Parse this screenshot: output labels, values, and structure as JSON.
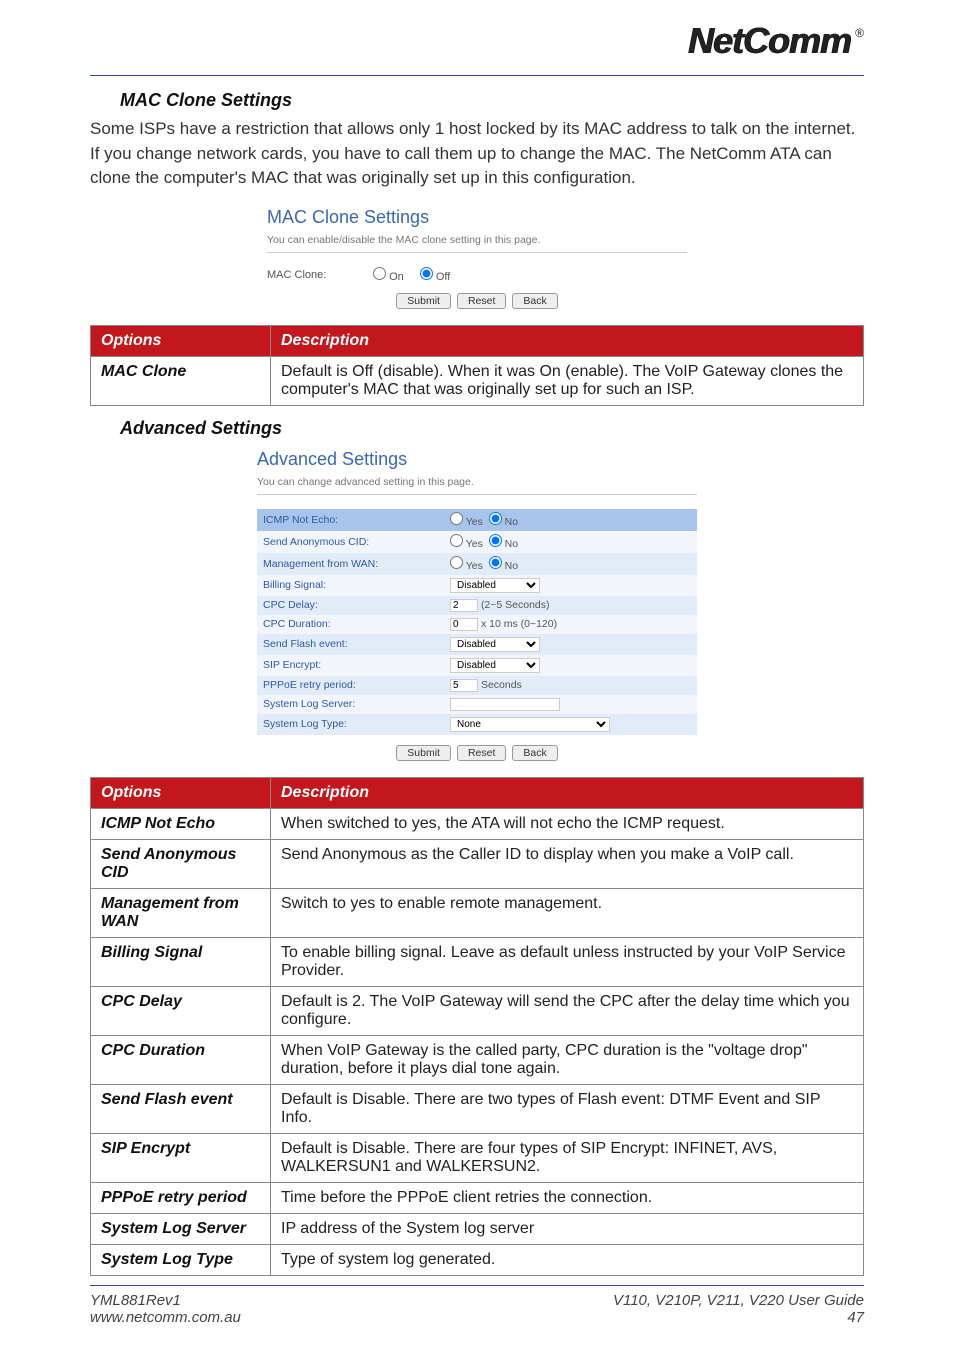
{
  "logo": "NetComm",
  "sections": {
    "macHead": "MAC Clone Settings",
    "macBody": "Some ISPs have a restriction that allows only 1 host locked by its MAC address to talk on the internet. If you change network cards, you have to call them up to change the MAC. The NetComm ATA can clone the computer's MAC that was originally set up in this configuration.",
    "advHead": "Advanced Settings"
  },
  "macPanel": {
    "title": "MAC Clone Settings",
    "sub": "You can enable/disable the MAC clone setting in this page.",
    "label": "MAC Clone:",
    "optOn": "On",
    "optOff": "Off",
    "btnSubmit": "Submit",
    "btnReset": "Reset",
    "btnBack": "Back"
  },
  "advPanel": {
    "title": "Advanced Settings",
    "sub": "You can change advanced setting in this page.",
    "rows": {
      "icmp": {
        "label": "ICMP Not Echo:",
        "yes": "Yes",
        "no": "No"
      },
      "cid": {
        "label": "Send Anonymous CID:",
        "yes": "Yes",
        "no": "No"
      },
      "mwan": {
        "label": "Management from WAN:",
        "yes": "Yes",
        "no": "No"
      },
      "bill": {
        "label": "Billing Signal:",
        "val": "Disabled"
      },
      "cpcd": {
        "label": "CPC Delay:",
        "val": "2",
        "unit": "(2~5 Seconds)"
      },
      "cpcdr": {
        "label": "CPC Duration:",
        "val": "0",
        "unit": "x 10 ms (0~120)"
      },
      "flash": {
        "label": "Send Flash event:",
        "val": "Disabled"
      },
      "sip": {
        "label": "SIP Encrypt:",
        "val": "Disabled"
      },
      "pppoe": {
        "label": "PPPoE retry period:",
        "val": "5",
        "unit": "Seconds"
      },
      "slog": {
        "label": "System Log Server:",
        "val": ""
      },
      "slogt": {
        "label": "System Log Type:",
        "val": "None"
      }
    },
    "btnSubmit": "Submit",
    "btnReset": "Reset",
    "btnBack": "Back"
  },
  "table1": {
    "h1": "Options",
    "h2": "Description",
    "rows": [
      {
        "opt": "MAC Clone",
        "desc": "Default is Off (disable). When it was On (enable). The VoIP Gateway clones the computer's MAC that was originally set up for such an ISP."
      }
    ]
  },
  "table2": {
    "h1": "Options",
    "h2": "Description",
    "rows": [
      {
        "opt": "ICMP Not Echo",
        "desc": "When switched to yes, the ATA will not echo the ICMP request."
      },
      {
        "opt": "Send Anonymous CID",
        "desc": "Send Anonymous as the Caller ID to display when you make a VoIP call."
      },
      {
        "opt": "Management from WAN",
        "desc": "Switch to yes to enable remote management."
      },
      {
        "opt": "Billing Signal",
        "desc": "To enable billing signal. Leave as default unless instructed by your VoIP Service Provider."
      },
      {
        "opt": "CPC Delay",
        "desc": "Default is 2. The VoIP Gateway will send the CPC after the delay time which you configure."
      },
      {
        "opt": "CPC Duration",
        "desc": "When VoIP Gateway is the called party, CPC duration is the \"voltage drop\" duration, before it plays dial tone again."
      },
      {
        "opt": "Send Flash event",
        "desc": "Default is Disable. There are two types of Flash event: DTMF Event and SIP Info."
      },
      {
        "opt": "SIP Encrypt",
        "desc": "Default is Disable. There are four types of SIP Encrypt: INFINET, AVS, WALKERSUN1 and WALKERSUN2."
      },
      {
        "opt": "PPPoE retry period",
        "desc": "Time before the PPPoE client retries the connection."
      },
      {
        "opt": "System Log Server",
        "desc": "IP address of the System log server"
      },
      {
        "opt": "System Log Type",
        "desc": "Type of system log generated."
      }
    ]
  },
  "footer": {
    "left1": "YML881Rev1",
    "left2": "www.netcomm.com.au",
    "right1": "V110, V210P, V211, V220 User Guide",
    "right2": "47"
  }
}
